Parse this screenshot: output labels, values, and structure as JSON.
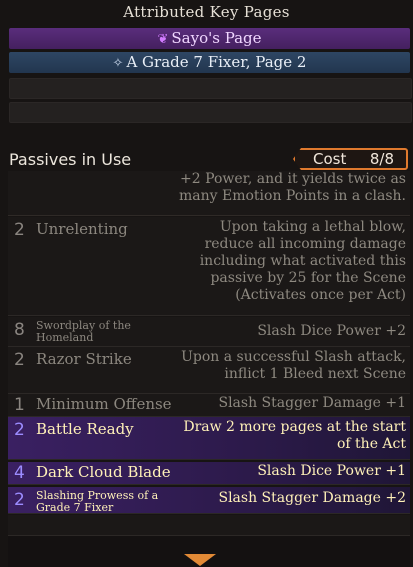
{
  "header": {
    "title": "Attributed Key Pages"
  },
  "key_pages": [
    {
      "label": "Sayo's Page",
      "icon": "sayo-emblem-icon"
    },
    {
      "label": "A Grade 7 Fixer, Page 2",
      "icon": "fixer-emblem-icon"
    }
  ],
  "passives": {
    "title": "Passives in Use",
    "cost_label": "Cost",
    "cost_value": "8/8",
    "rows": [
      {
        "cost": "",
        "name": "",
        "desc": "+2 Power, and it yields twice as many Emotion Points in a clash."
      },
      {
        "cost": "2",
        "name": "Unrelenting",
        "desc": "Upon taking a lethal blow, reduce all incoming damage including what activated this passive by 25 for the Scene (Activates once per Act)"
      },
      {
        "cost": "8",
        "name": "Swordplay of the Homeland",
        "desc": "Slash Dice Power +2"
      },
      {
        "cost": "2",
        "name": "Razor Strike",
        "desc": "Upon a successful Slash attack, inflict 1 Bleed next Scene"
      },
      {
        "cost": "1",
        "name": "Minimum Offense",
        "desc": "Slash Stagger Damage +1"
      },
      {
        "cost": "2",
        "name": "Battle Ready",
        "desc": "Draw 2 more pages at the start of the Act"
      },
      {
        "cost": "4",
        "name": "Dark Cloud Blade",
        "desc": "Slash Dice Power +1"
      },
      {
        "cost": "2",
        "name": "Slashing Prowess of a Grade 7 Fixer",
        "desc": "Slash Stagger Damage +2"
      }
    ]
  },
  "colors": {
    "accent_orange": "#e07a2e",
    "sayo_purple": "#5a2d7c",
    "fixer_blue": "#2e4664",
    "active_text": "#fff1b8"
  }
}
